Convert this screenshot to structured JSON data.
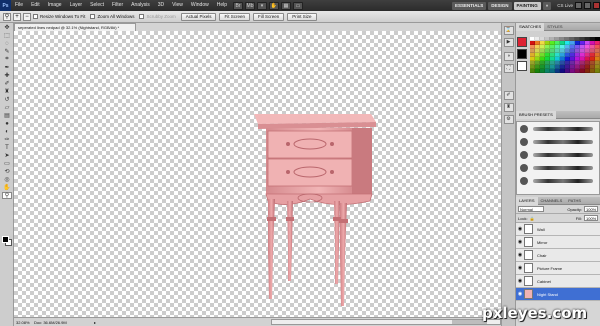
{
  "menubar": {
    "app_icon": "Ps",
    "items": [
      "File",
      "Edit",
      "Image",
      "Layer",
      "Select",
      "Filter",
      "Analysis",
      "3D",
      "View",
      "Window",
      "Help"
    ],
    "workspaces": [
      "ESSENTIALS",
      "DESIGN",
      "PAINTING"
    ],
    "active_workspace": "PAINTING",
    "cs_live": "CS Live"
  },
  "options": {
    "checkboxes": [
      "Resize Windows To Fit",
      "Zoom All Windows",
      "Scrubby Zoom"
    ],
    "buttons": [
      "Actual Pixels",
      "Fit Screen",
      "Fill Screen",
      "Print Size"
    ]
  },
  "document": {
    "tab_title": "seperated lines nedpad @ 32.1% (Nightstand, RGB/8#) *",
    "zoom": "32.08%",
    "doc_size": "Doc: 36.6M/26.9M"
  },
  "panels": {
    "swatch_tabs": [
      "SWATCHES",
      "STYLES"
    ],
    "brush_tabs": [
      "BRUSH PRESETS"
    ],
    "layer_tabs": [
      "LAYERS",
      "CHANNELS",
      "PATHS"
    ],
    "blend_mode": "Normal",
    "opacity_label": "Opacity:",
    "opacity": "100%",
    "lock_label": "Lock:",
    "fill_label": "Fill:",
    "fill": "100%",
    "layers": [
      {
        "name": "Wall",
        "selected": false
      },
      {
        "name": "Mirror",
        "selected": false
      },
      {
        "name": "Chair",
        "selected": false
      },
      {
        "name": "Picture Frame",
        "selected": false
      },
      {
        "name": "Cabinet",
        "selected": false
      },
      {
        "name": "Night Stand",
        "selected": true
      }
    ]
  },
  "watermark": "pxleyes.com",
  "colors": {
    "nightstand": "#e9a3a4",
    "nightstand_shadow": "#c46f74",
    "selected_layer": "#3f6fd3"
  }
}
